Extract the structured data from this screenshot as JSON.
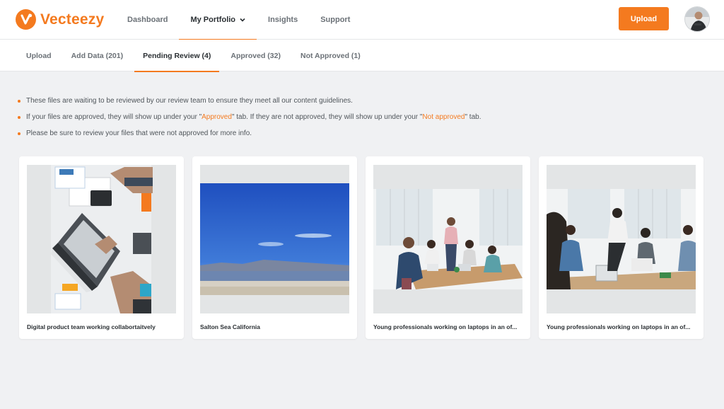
{
  "brand": {
    "name": "Vecteezy",
    "logo_icon": "vecteezy-v-logo-icon",
    "accent_color": "#f47a1f"
  },
  "nav": {
    "items": [
      {
        "label": "Dashboard"
      },
      {
        "label": "My Portfolio",
        "active": true
      },
      {
        "label": "Insights"
      },
      {
        "label": "Support"
      }
    ]
  },
  "header": {
    "upload_label": "Upload",
    "avatar_icon": "user-avatar"
  },
  "tabs": [
    {
      "label": "Upload"
    },
    {
      "label": "Add Data (201)"
    },
    {
      "label": "Pending Review (4)",
      "active": true
    },
    {
      "label": "Approved (32)"
    },
    {
      "label": "Not Approved (1)"
    }
  ],
  "notes": {
    "line1": "These files are waiting to be reviewed by our review team to ensure they meet all our content guidelines.",
    "line2_a": "If your files are approved, they will show up under your \"",
    "line2_approved": "Approved",
    "line2_b": "\" tab. If they are not approved, they will show up under your \"",
    "line2_not_approved": "Not approved",
    "line2_c": "\" tab.",
    "line3": "Please be sure to review your files that were not approved for more info."
  },
  "cards": [
    {
      "title": "Digital product team working collabortaitvely"
    },
    {
      "title": "Salton Sea California"
    },
    {
      "title": "Young professionals working on laptops in an of..."
    },
    {
      "title": "Young professionals working on laptops in an of..."
    }
  ]
}
